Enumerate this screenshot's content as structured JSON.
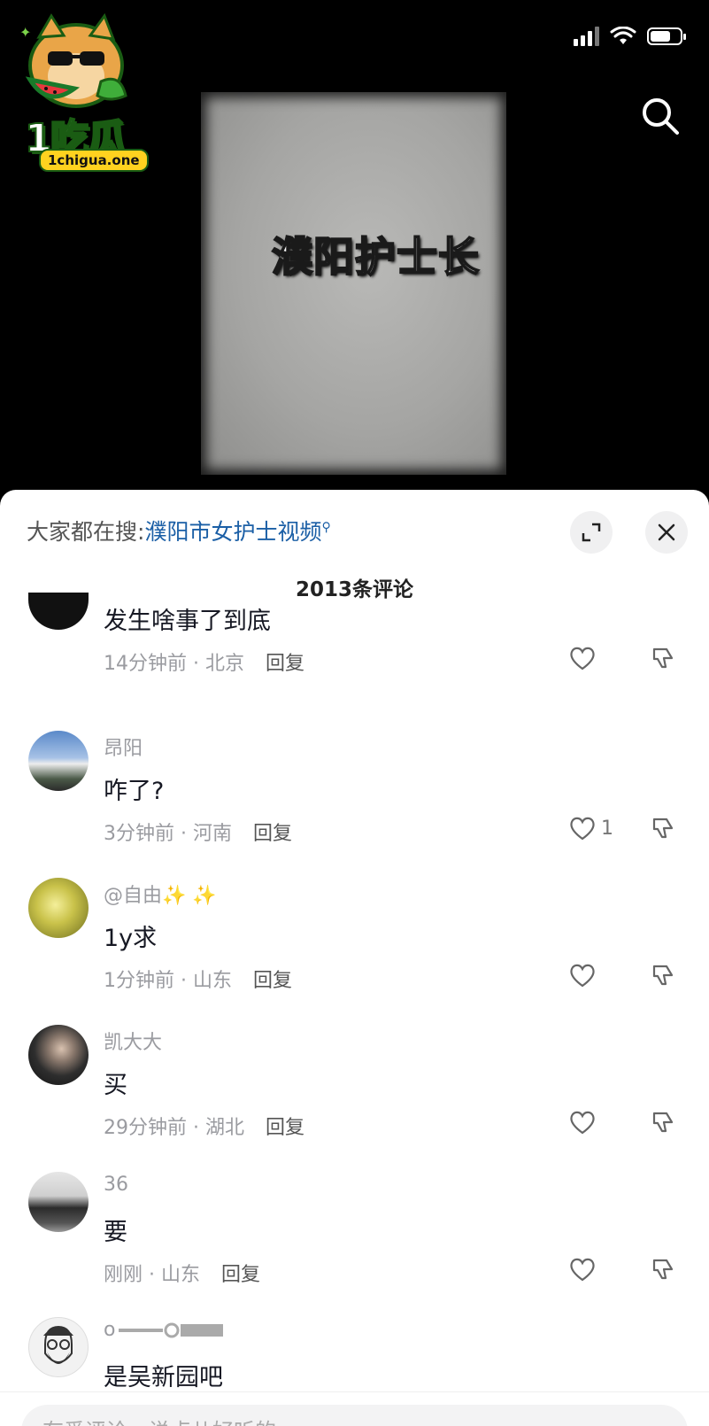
{
  "logo": {
    "text": "1吃瓜",
    "domain": "1chigua.one"
  },
  "video": {
    "overlay_text": "濮阳护士长"
  },
  "sheet": {
    "hot_search_prefix": "大家都在搜:",
    "hot_search_keyword": "濮阳市女护士视频",
    "comment_count": "2013条评论",
    "comments": [
      {
        "name": "",
        "text": "发生啥事了到底",
        "meta": "14分钟前 · 北京",
        "reply": "回复",
        "likes": ""
      },
      {
        "name": "昂阳",
        "text": "咋了?",
        "meta": "3分钟前 · 河南",
        "reply": "回复",
        "likes": "1"
      },
      {
        "name": "@自由✨ ✨",
        "text": "1y求",
        "meta": "1分钟前 · 山东",
        "reply": "回复",
        "likes": ""
      },
      {
        "name": "凯大大",
        "text": "买",
        "meta": "29分钟前 · 湖北",
        "reply": "回复",
        "likes": ""
      },
      {
        "name": "36",
        "text": "要",
        "meta": "刚刚 · 山东",
        "reply": "回复",
        "likes": ""
      },
      {
        "name": "o",
        "text": "是吴新园吧",
        "meta": "",
        "reply": "",
        "likes": ""
      }
    ],
    "input_placeholder": "有爱评论，说点儿好听的"
  },
  "colors": {
    "link": "#1b5fa6",
    "muted": "#9a9ba0",
    "sheet_bg": "#ffffff",
    "page_bg": "#000000"
  }
}
